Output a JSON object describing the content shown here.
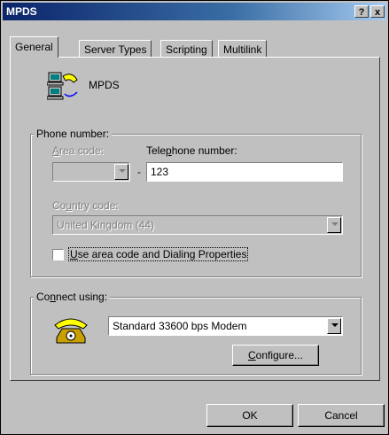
{
  "window": {
    "title": "MPDS",
    "help_label": "?",
    "close_label": "x"
  },
  "tabs": [
    {
      "label": "General"
    },
    {
      "label": "Server Types"
    },
    {
      "label": "Scripting"
    },
    {
      "label": "Multilink"
    }
  ],
  "general": {
    "connection_name": "MPDS",
    "phone_group_label": "Phone number:",
    "area_code_label": "Area code:",
    "area_code_value": "",
    "separator": "-",
    "telephone_label": "Telephone number:",
    "telephone_value": "123",
    "country_code_label": "Country code:",
    "country_code_value": "United Kingdom (44)",
    "use_area_code_label": "Use area code and Dialing Properties",
    "use_area_code_checked": false,
    "connect_group_label": "Connect using:",
    "modem_value": "Standard 33600 bps Modem",
    "configure_label": "Configure..."
  },
  "footer": {
    "ok_label": "OK",
    "cancel_label": "Cancel"
  },
  "colors": {
    "face": "#c0c0c0",
    "title_start": "#0a246a",
    "title_end": "#a6caf0",
    "disabled_text": "#808080"
  }
}
